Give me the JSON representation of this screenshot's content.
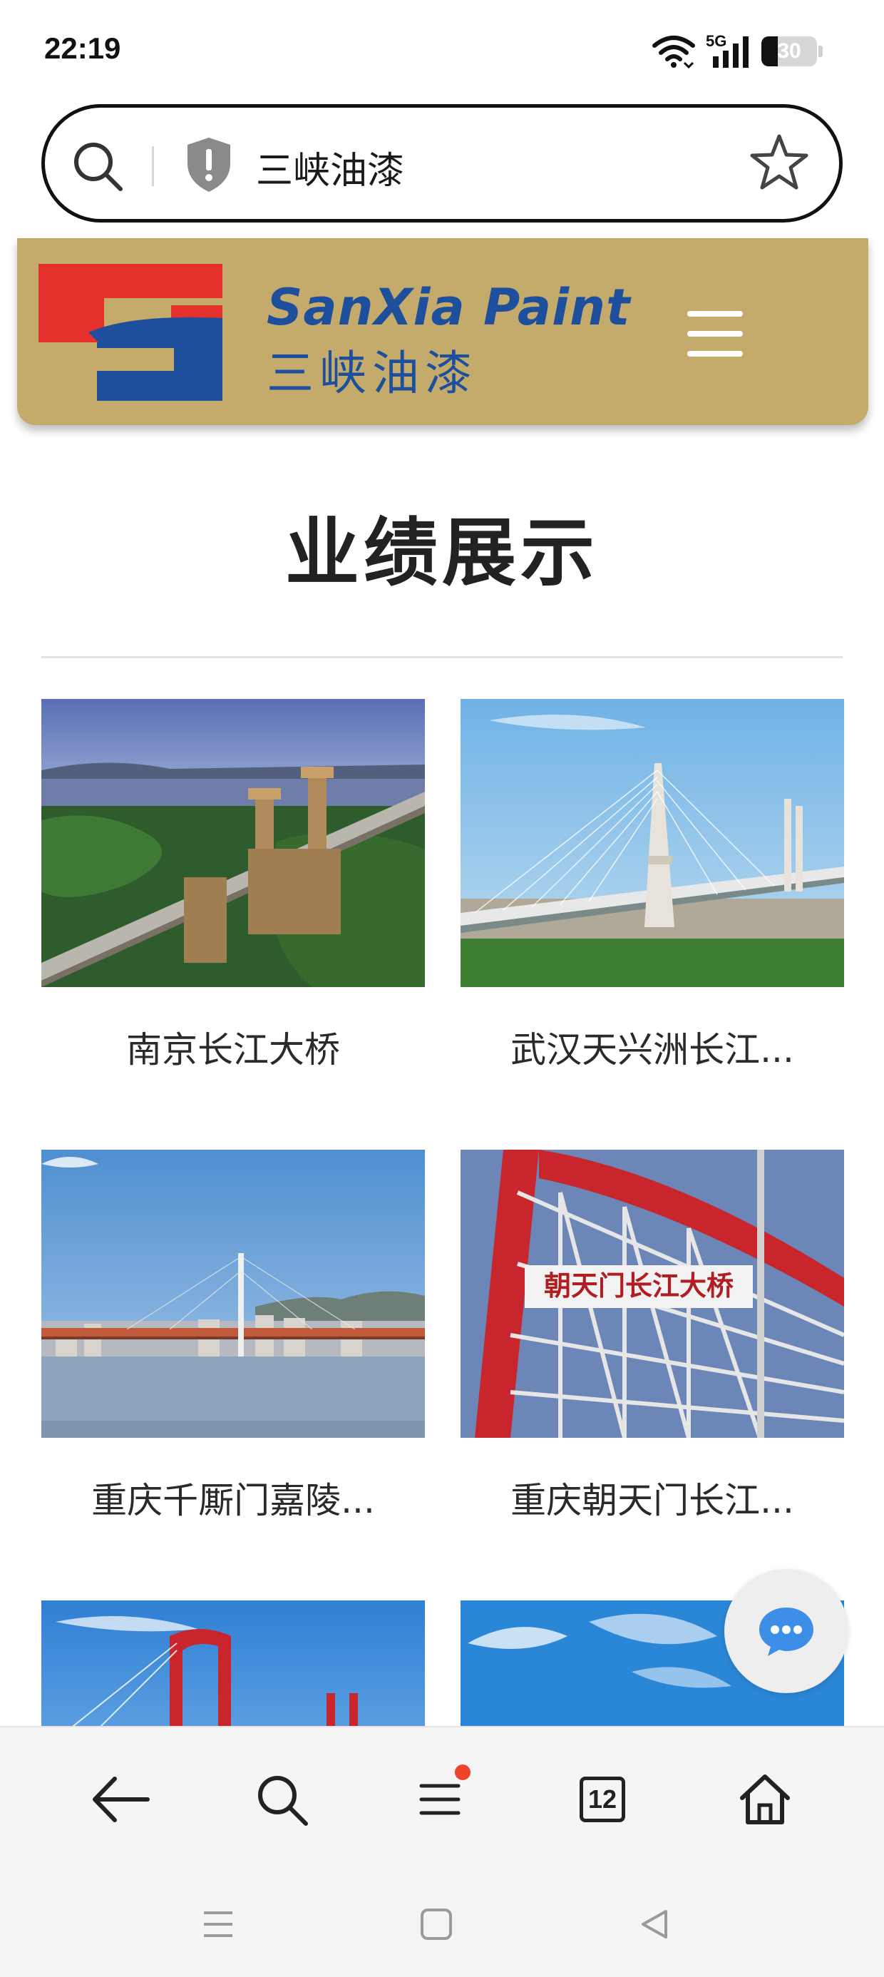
{
  "status_bar": {
    "time": "22:19",
    "network": "5G",
    "battery_level": "30",
    "icons": [
      "wifi-icon",
      "cellular-signal-icon",
      "battery-icon"
    ]
  },
  "address_bar": {
    "query": "三峡油漆",
    "icons": [
      "search-icon",
      "shield-alert-icon",
      "star-icon"
    ]
  },
  "site_header": {
    "logo_en": "SanXia Paint",
    "logo_cn": "三峡油漆",
    "menu_icon": "hamburger-menu-icon",
    "colors": {
      "header_bg": "#c4ab6c",
      "logo_blue": "#1d4f9c",
      "logo_red": "#e5312b"
    }
  },
  "main": {
    "title": "业绩展示",
    "projects": [
      {
        "caption": "南京长江大桥"
      },
      {
        "caption": "武汉天兴洲长江..."
      },
      {
        "caption": "重庆千厮门嘉陵..."
      },
      {
        "caption": "重庆朝天门长江..."
      },
      {
        "caption": ""
      },
      {
        "caption": ""
      }
    ],
    "sign_text": "朝天门长江大桥"
  },
  "floating": {
    "chat_icon": "chat-bubble-icon",
    "color": "#3c8ee6"
  },
  "toolbar": {
    "tabs_count": "12",
    "items": [
      "back-arrow-icon",
      "search-icon",
      "menu-list-icon",
      "tabs-icon",
      "home-icon"
    ],
    "notification_dot_color": "#f0432c"
  },
  "system_nav": {
    "items": [
      "recents-icon",
      "home-square-icon",
      "back-triangle-icon"
    ]
  }
}
